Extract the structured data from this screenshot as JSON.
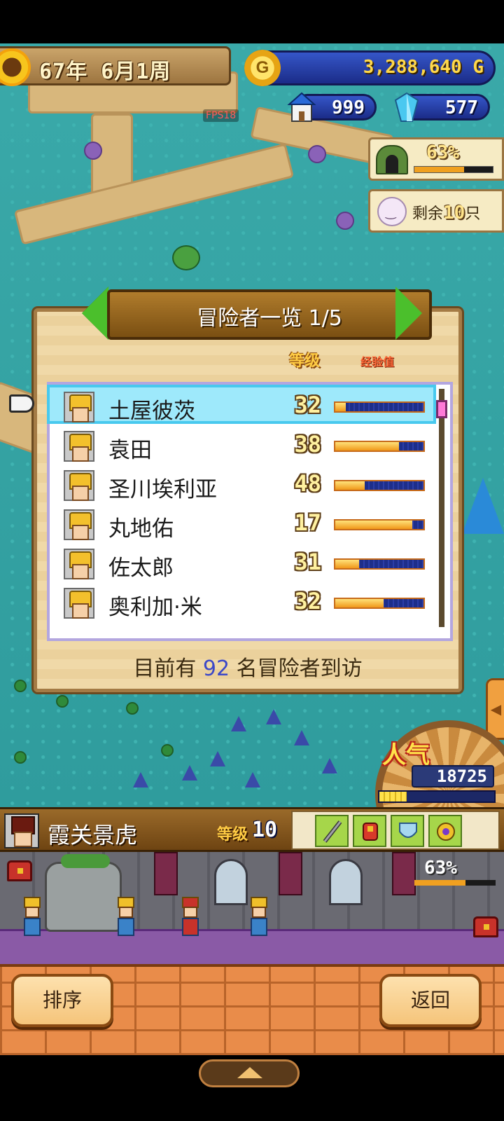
{
  "hud": {
    "date": "67年 6月1周",
    "gold": "3,288,640",
    "gold_unit": "G",
    "coin_letter": "G",
    "houses": "999",
    "crystals": "577",
    "fps": "FPS18",
    "dungeon_percent": "63%",
    "dungeon_progress": 0.63,
    "remaining_prefix": "剩余",
    "remaining_count": "10",
    "remaining_suffix": "只"
  },
  "dialog": {
    "title": "冒险者一览 1/5",
    "col_level": "等级",
    "col_exp": "经验值",
    "adventurers": [
      {
        "name": "土屋彼茨",
        "level": "32",
        "exp": 0.12,
        "selected": true
      },
      {
        "name": "袁田",
        "level": "38",
        "exp": 0.72
      },
      {
        "name": "圣川埃利亚",
        "level": "48",
        "exp": 0.33
      },
      {
        "name": "丸地佑",
        "level": "17",
        "exp": 0.87
      },
      {
        "name": "佐太郎",
        "level": "31",
        "exp": 0.27
      },
      {
        "name": "奥利加·米",
        "level": "32",
        "exp": 0.55
      }
    ],
    "visit_prefix": "目前有",
    "visit_count": "92",
    "visit_suffix": "名冒险者到访"
  },
  "popularity": {
    "label": "人气",
    "value": "18725",
    "progress": 0.24
  },
  "hero": {
    "name": "霞关景虎",
    "level_label": "等级",
    "level": "10",
    "equipment": [
      "sword-icon",
      "armor-icon",
      "shield-icon",
      "amulet-icon"
    ]
  },
  "castle": {
    "percent": "63%",
    "progress": 0.63
  },
  "buttons": {
    "sort": "排序",
    "back": "返回"
  },
  "colors": {
    "selected_row": "#9ee9fb",
    "exp_fill": "#f0981a",
    "level_text": "#fff1a0",
    "visit_count": "#3c48c8"
  }
}
